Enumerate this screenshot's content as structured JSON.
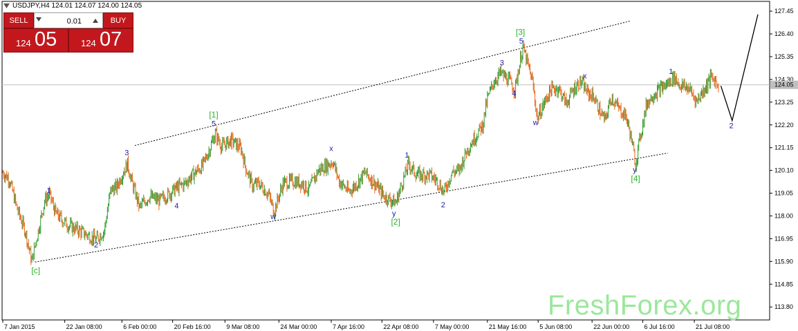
{
  "symbol_title": "USDJPY,H4  124.01 124.07 124.00 124.05",
  "trade_panel": {
    "sell_label": "SELL",
    "buy_label": "BUY",
    "lot_value": "0.01",
    "sell_price_small": "124",
    "sell_price_big": "05",
    "buy_price_small": "124",
    "buy_price_big": "07"
  },
  "watermark": "FreshForex.org",
  "colors": {
    "bull_candle": "#2e9a2e",
    "bear_candle": "#e8661a",
    "wave_label_blue": "#1b1ba6",
    "wave_label_green": "#29b229",
    "panel_red": "#c2181d",
    "current_price_box": "#c0c0c0"
  },
  "chart_data": {
    "type": "candlestick",
    "symbol": "USDJPY",
    "timeframe": "H4",
    "ylim": [
      113.2,
      127.9
    ],
    "y_ticks": [
      "127.45",
      "126.40",
      "125.35",
      "124.30",
      "123.25",
      "122.20",
      "121.15",
      "120.10",
      "119.05",
      "118.00",
      "116.95",
      "115.90",
      "114.85",
      "113.80"
    ],
    "current_price": "124.05",
    "x_ticks": [
      {
        "i": 0,
        "label": "7 Jan 2015"
      },
      {
        "i": 77,
        "label": "22 Jan 08:00"
      },
      {
        "i": 148,
        "label": "6 Feb 00:00"
      },
      {
        "i": 211,
        "label": "20 Feb 16:00"
      },
      {
        "i": 276,
        "label": "9 Mar 08:00"
      },
      {
        "i": 343,
        "label": "24 Mar 00:00"
      },
      {
        "i": 408,
        "label": "7 Apr 16:00"
      },
      {
        "i": 471,
        "label": "22 Apr 08:00"
      },
      {
        "i": 535,
        "label": "7 May 00:00"
      },
      {
        "i": 602,
        "label": "21 May 16:00"
      },
      {
        "i": 665,
        "label": "5 Jun 08:00"
      },
      {
        "i": 732,
        "label": "22 Jun 00:00"
      },
      {
        "i": 795,
        "label": "6 Jul 16:00"
      },
      {
        "i": 859,
        "label": "21 Jul 08:00"
      }
    ],
    "n_bars": 890,
    "price_path": [
      [
        0,
        120.0
      ],
      [
        8,
        119.7
      ],
      [
        18,
        118.3
      ],
      [
        28,
        117.3
      ],
      [
        36,
        115.9
      ],
      [
        44,
        117.3
      ],
      [
        52,
        118.7
      ],
      [
        58,
        119.0
      ],
      [
        66,
        118.1
      ],
      [
        80,
        117.6
      ],
      [
        96,
        117.3
      ],
      [
        116,
        116.9
      ],
      [
        126,
        117.3
      ],
      [
        134,
        119.2
      ],
      [
        141,
        119.3
      ],
      [
        148,
        119.9
      ],
      [
        155,
        120.4
      ],
      [
        160,
        119.6
      ],
      [
        170,
        118.4
      ],
      [
        182,
        118.9
      ],
      [
        194,
        118.7
      ],
      [
        206,
        119.0
      ],
      [
        216,
        119.3
      ],
      [
        226,
        119.5
      ],
      [
        236,
        119.9
      ],
      [
        248,
        120.3
      ],
      [
        256,
        121.0
      ],
      [
        264,
        121.8
      ],
      [
        272,
        121.2
      ],
      [
        284,
        121.5
      ],
      [
        296,
        121.1
      ],
      [
        302,
        120.2
      ],
      [
        310,
        119.4
      ],
      [
        318,
        119.5
      ],
      [
        330,
        119.0
      ],
      [
        337,
        118.2
      ],
      [
        348,
        119.5
      ],
      [
        360,
        119.6
      ],
      [
        372,
        119.5
      ],
      [
        380,
        119.2
      ],
      [
        392,
        120.1
      ],
      [
        410,
        120.5
      ],
      [
        418,
        119.6
      ],
      [
        430,
        119.1
      ],
      [
        440,
        119.5
      ],
      [
        450,
        120.0
      ],
      [
        462,
        119.5
      ],
      [
        474,
        118.9
      ],
      [
        488,
        118.6
      ],
      [
        496,
        119.5
      ],
      [
        504,
        120.4
      ],
      [
        514,
        119.9
      ],
      [
        530,
        119.9
      ],
      [
        540,
        119.6
      ],
      [
        548,
        119.1
      ],
      [
        558,
        120.0
      ],
      [
        567,
        120.1
      ],
      [
        576,
        121.0
      ],
      [
        586,
        121.6
      ],
      [
        596,
        122.2
      ],
      [
        602,
        123.4
      ],
      [
        610,
        124.2
      ],
      [
        618,
        124.6
      ],
      [
        630,
        124.2
      ],
      [
        636,
        123.8
      ],
      [
        646,
        125.8
      ],
      [
        652,
        125.0
      ],
      [
        658,
        124.2
      ],
      [
        664,
        122.5
      ],
      [
        670,
        123.0
      ],
      [
        680,
        123.8
      ],
      [
        690,
        123.9
      ],
      [
        700,
        123.2
      ],
      [
        710,
        123.9
      ],
      [
        718,
        124.2
      ],
      [
        726,
        123.7
      ],
      [
        734,
        123.5
      ],
      [
        742,
        122.8
      ],
      [
        748,
        122.4
      ],
      [
        756,
        123.5
      ],
      [
        764,
        123.0
      ],
      [
        774,
        122.6
      ],
      [
        780,
        121.7
      ],
      [
        786,
        120.4
      ],
      [
        792,
        121.7
      ],
      [
        800,
        123.2
      ],
      [
        808,
        123.6
      ],
      [
        818,
        123.9
      ],
      [
        826,
        124.1
      ],
      [
        834,
        124.4
      ],
      [
        842,
        124.0
      ],
      [
        852,
        123.9
      ],
      [
        862,
        123.3
      ],
      [
        872,
        123.9
      ],
      [
        880,
        124.4
      ],
      [
        890,
        124.05
      ]
    ],
    "channel_lines": [
      {
        "from": [
          164,
          121.25
        ],
        "to": [
          780,
          127.0
        ]
      },
      {
        "from": [
          40,
          115.87
        ],
        "to": [
          826,
          120.9
        ]
      }
    ],
    "projection": [
      [
        892,
        124.0
      ],
      [
        906,
        122.4
      ],
      [
        938,
        127.3
      ]
    ],
    "wave_labels": [
      {
        "text": "1",
        "i": 57,
        "p": 119.05,
        "color": "blue"
      },
      {
        "text": "2",
        "i": 116,
        "p": 116.55,
        "color": "blue"
      },
      {
        "text": "3",
        "i": 154,
        "p": 120.8,
        "color": "blue"
      },
      {
        "text": "4",
        "i": 216,
        "p": 118.35,
        "color": "blue"
      },
      {
        "text": "[c]",
        "i": 41,
        "p": 115.35,
        "color": "green"
      },
      {
        "text": "5",
        "i": 262,
        "p": 122.15,
        "color": "blue"
      },
      {
        "text": "[1]",
        "i": 262,
        "p": 122.55,
        "color": "green"
      },
      {
        "text": "w",
        "i": 336,
        "p": 117.85,
        "color": "blue"
      },
      {
        "text": "x",
        "i": 408,
        "p": 121.0,
        "color": "blue"
      },
      {
        "text": "1",
        "i": 502,
        "p": 120.7,
        "color": "blue"
      },
      {
        "text": "y",
        "i": 486,
        "p": 118.0,
        "color": "blue"
      },
      {
        "text": "[2]",
        "i": 488,
        "p": 117.6,
        "color": "green"
      },
      {
        "text": "2",
        "i": 547,
        "p": 118.4,
        "color": "blue"
      },
      {
        "text": "3",
        "i": 620,
        "p": 124.95,
        "color": "blue"
      },
      {
        "text": "4",
        "i": 635,
        "p": 123.55,
        "color": "blue"
      },
      {
        "text": "5",
        "i": 644,
        "p": 125.95,
        "color": "blue"
      },
      {
        "text": "[3]",
        "i": 643,
        "p": 126.35,
        "color": "green"
      },
      {
        "text": "w",
        "i": 662,
        "p": 122.2,
        "color": "blue"
      },
      {
        "text": "x",
        "i": 723,
        "p": 124.35,
        "color": "blue"
      },
      {
        "text": "1",
        "i": 830,
        "p": 124.55,
        "color": "blue"
      },
      {
        "text": "y",
        "i": 785,
        "p": 120.0,
        "color": "blue"
      },
      {
        "text": "[4]",
        "i": 786,
        "p": 119.6,
        "color": "green"
      },
      {
        "text": "2",
        "i": 905,
        "p": 122.05,
        "color": "blue"
      }
    ]
  }
}
